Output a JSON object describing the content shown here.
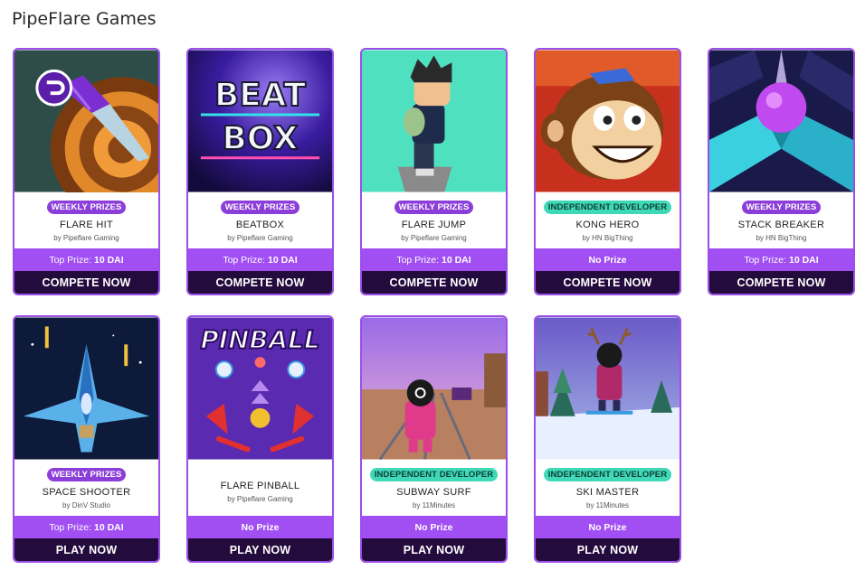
{
  "page": {
    "title": "PipeFlare Games"
  },
  "games": [
    {
      "badge": "WEEKLY PRIZES",
      "badge_type": "weekly",
      "title": "FLARE HIT",
      "developer": "by Pipeflare Gaming",
      "prize_label": "Top Prize:",
      "prize_value": "10 DAI",
      "cta": "COMPETE NOW",
      "thumb_icon": "knife-target-icon"
    },
    {
      "badge": "WEEKLY PRIZES",
      "badge_type": "weekly",
      "title": "BEATBOX",
      "developer": "by Pipeflare Gaming",
      "prize_label": "Top Prize:",
      "prize_value": "10 DAI",
      "cta": "COMPETE NOW",
      "thumb_icon": "beatbox-logo-icon",
      "thumb_text": [
        "BEAT",
        "BOX"
      ]
    },
    {
      "badge": "WEEKLY PRIZES",
      "badge_type": "weekly",
      "title": "FLARE JUMP",
      "developer": "by Pipeflare Gaming",
      "prize_label": "Top Prize:",
      "prize_value": "10 DAI",
      "cta": "COMPETE NOW",
      "thumb_icon": "jumping-boy-icon"
    },
    {
      "badge": "INDEPENDENT DEVELOPER",
      "badge_type": "indie",
      "title": "KONG HERO",
      "developer": "by HN BigThing",
      "prize_label": "",
      "prize_value": "No Prize",
      "cta": "COMPETE NOW",
      "thumb_icon": "monkey-face-icon"
    },
    {
      "badge": "WEEKLY PRIZES",
      "badge_type": "weekly",
      "title": "STACK BREAKER",
      "developer": "by HN BigThing",
      "prize_label": "Top Prize:",
      "prize_value": "10 DAI",
      "cta": "COMPETE NOW",
      "thumb_icon": "bouncing-ball-icon"
    },
    {
      "badge": "WEEKLY PRIZES",
      "badge_type": "weekly",
      "title": "SPACE SHOOTER",
      "developer": "by DinV Studio",
      "prize_label": "Top Prize:",
      "prize_value": "10 DAI",
      "cta": "PLAY NOW",
      "thumb_icon": "spaceship-icon"
    },
    {
      "badge": "",
      "badge_type": "",
      "title": "FLARE PINBALL",
      "developer": "by Pipeflare Gaming",
      "prize_label": "",
      "prize_value": "No Prize",
      "cta": "PLAY NOW",
      "thumb_icon": "pinball-table-icon",
      "thumb_text": [
        "PINBALL"
      ]
    },
    {
      "badge": "INDEPENDENT DEVELOPER",
      "badge_type": "indie",
      "title": "SUBWAY SURF",
      "developer": "by 11Minutes",
      "prize_label": "",
      "prize_value": "No Prize",
      "cta": "PLAY NOW",
      "thumb_icon": "subway-runner-icon"
    },
    {
      "badge": "INDEPENDENT DEVELOPER",
      "badge_type": "indie",
      "title": "SKI MASTER",
      "developer": "by 11Minutes",
      "prize_label": "",
      "prize_value": "No Prize",
      "cta": "PLAY NOW",
      "thumb_icon": "skier-icon"
    }
  ]
}
